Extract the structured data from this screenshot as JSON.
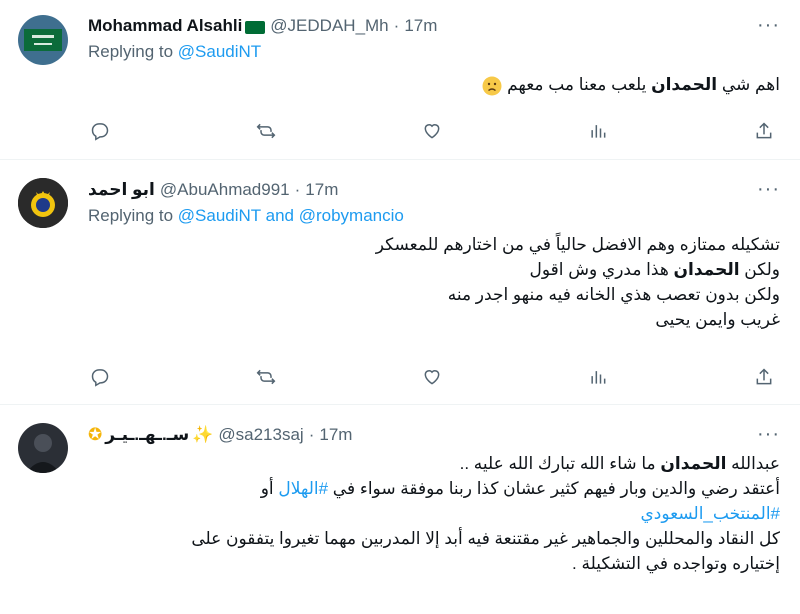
{
  "tweets": [
    {
      "name": "Mohammad Alsahli",
      "handle": "@JEDDAH_Mh",
      "dot": "·",
      "time": "17m",
      "replying_prefix": "Replying to",
      "replying_to": "@SaudiNT",
      "replying_and": "",
      "replying_to2": "",
      "text_before": "اهم شي ",
      "text_bold": "الحمدان",
      "text_after": " يلعب معنا مب معهم",
      "emoji_icon": "worried-face-emoji"
    },
    {
      "name": "ابو احمد",
      "handle": "@AbuAhmad991",
      "dot": "·",
      "time": "17m",
      "replying_prefix": "Replying to",
      "replying_to": "@SaudiNT",
      "replying_and": " and ",
      "replying_to2": "@robymancio",
      "line1": "تشكيله ممتازه وهم الافضل حالياً في من اختارهم للمعسكر",
      "line2_before": "ولكن ",
      "line2_bold": "الحمدان",
      "line2_after": " هذا مدري وش اقول",
      "line3": "ولكن بدون تعصب هذي الخانه فيه منهو اجدر منه",
      "line4": "غريب وايمن يحيى"
    },
    {
      "name": "سـ.ـهـ.ـيـر",
      "handle": "@sa213saj",
      "dot": "·",
      "time": "17m",
      "line1_before": "عبدالله ",
      "line1_bold": "الحمدان",
      "line1_after": " ما شاء الله تبارك الله عليه ..",
      "line2_before": "أعتقد رضي والدين وبار فيهم كثير عشان كذا ربنا موفقة سواء في ",
      "line2_hashtag": "#الهلال",
      "line2_after": " أو",
      "line3_hashtag": "#المنتخب_السعودي",
      "line4": "كل النقاد والمحللين والجماهير غير مقتنعة فيه أبد إلا المدربين مهما تغيروا يتفقون على",
      "line5": "إختياره وتواجده في التشكيلة ."
    }
  ],
  "more_label": "···",
  "colors": {
    "accent": "#1d9bf0",
    "muted": "#536471",
    "text": "#0f1419"
  }
}
